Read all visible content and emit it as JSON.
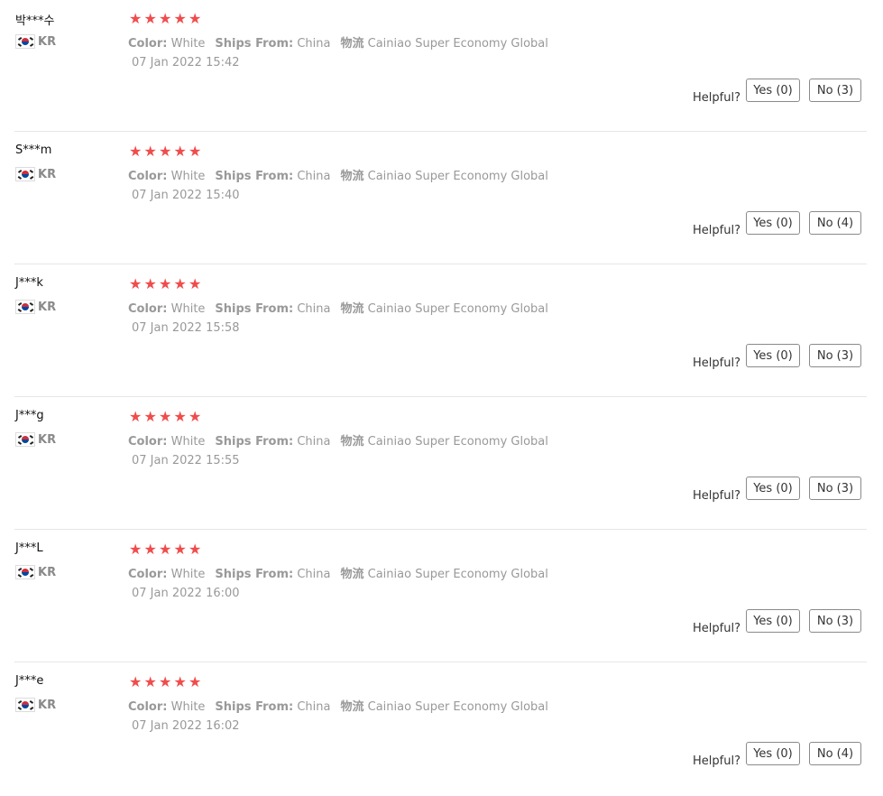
{
  "colors": {
    "star": "#f04c4c",
    "muted": "#999999",
    "divider": "#e6e6e6"
  },
  "icons": {
    "star": "star-icon",
    "flag": "kr-flag-icon"
  },
  "labels": {
    "color_key": "Color:",
    "ships_key": "Ships From:",
    "logistics_key": "物流",
    "helpful": "Helpful?"
  },
  "reviews": [
    {
      "user": "박***수",
      "country": "KR",
      "rating": 5,
      "color": "White",
      "ships_from": "China",
      "logistics": "Cainiao Super Economy Global",
      "date": "07 Jan 2022 15:42",
      "yes": "Yes (0)",
      "no": "No (3)"
    },
    {
      "user": "S***m",
      "country": "KR",
      "rating": 5,
      "color": "White",
      "ships_from": "China",
      "logistics": "Cainiao Super Economy Global",
      "date": "07 Jan 2022 15:40",
      "yes": "Yes (0)",
      "no": "No (4)"
    },
    {
      "user": "J***k",
      "country": "KR",
      "rating": 5,
      "color": "White",
      "ships_from": "China",
      "logistics": "Cainiao Super Economy Global",
      "date": "07 Jan 2022 15:58",
      "yes": "Yes (0)",
      "no": "No (3)"
    },
    {
      "user": "J***g",
      "country": "KR",
      "rating": 5,
      "color": "White",
      "ships_from": "China",
      "logistics": "Cainiao Super Economy Global",
      "date": "07 Jan 2022 15:55",
      "yes": "Yes (0)",
      "no": "No (3)"
    },
    {
      "user": "J***L",
      "country": "KR",
      "rating": 5,
      "color": "White",
      "ships_from": "China",
      "logistics": "Cainiao Super Economy Global",
      "date": "07 Jan 2022 16:00",
      "yes": "Yes (0)",
      "no": "No (3)"
    },
    {
      "user": "J***e",
      "country": "KR",
      "rating": 5,
      "color": "White",
      "ships_from": "China",
      "logistics": "Cainiao Super Economy Global",
      "date": "07 Jan 2022 16:02",
      "yes": "Yes (0)",
      "no": "No (4)"
    }
  ]
}
